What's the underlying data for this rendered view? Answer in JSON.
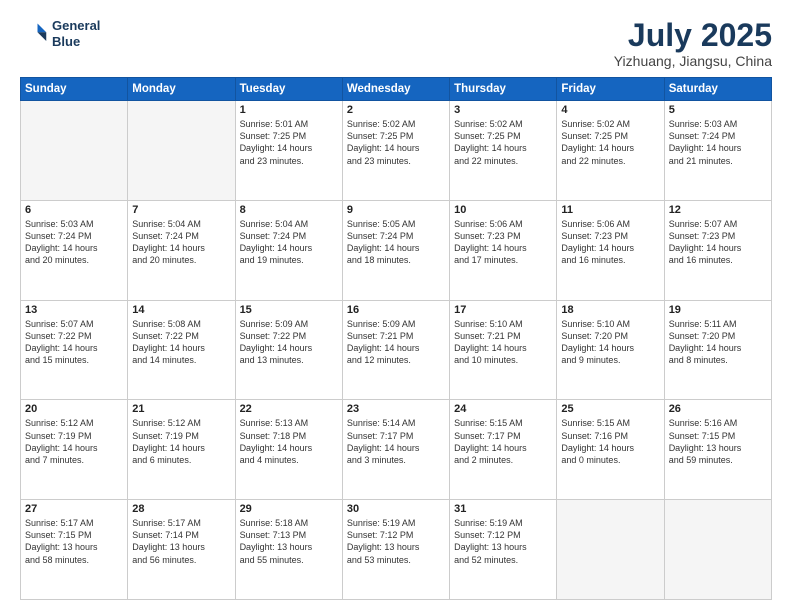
{
  "header": {
    "logo_line1": "General",
    "logo_line2": "Blue",
    "title": "July 2025",
    "subtitle": "Yizhuang, Jiangsu, China"
  },
  "calendar": {
    "days_of_week": [
      "Sunday",
      "Monday",
      "Tuesday",
      "Wednesday",
      "Thursday",
      "Friday",
      "Saturday"
    ],
    "weeks": [
      [
        {
          "day": "",
          "text": ""
        },
        {
          "day": "",
          "text": ""
        },
        {
          "day": "1",
          "text": "Sunrise: 5:01 AM\nSunset: 7:25 PM\nDaylight: 14 hours\nand 23 minutes."
        },
        {
          "day": "2",
          "text": "Sunrise: 5:02 AM\nSunset: 7:25 PM\nDaylight: 14 hours\nand 23 minutes."
        },
        {
          "day": "3",
          "text": "Sunrise: 5:02 AM\nSunset: 7:25 PM\nDaylight: 14 hours\nand 22 minutes."
        },
        {
          "day": "4",
          "text": "Sunrise: 5:02 AM\nSunset: 7:25 PM\nDaylight: 14 hours\nand 22 minutes."
        },
        {
          "day": "5",
          "text": "Sunrise: 5:03 AM\nSunset: 7:24 PM\nDaylight: 14 hours\nand 21 minutes."
        }
      ],
      [
        {
          "day": "6",
          "text": "Sunrise: 5:03 AM\nSunset: 7:24 PM\nDaylight: 14 hours\nand 20 minutes."
        },
        {
          "day": "7",
          "text": "Sunrise: 5:04 AM\nSunset: 7:24 PM\nDaylight: 14 hours\nand 20 minutes."
        },
        {
          "day": "8",
          "text": "Sunrise: 5:04 AM\nSunset: 7:24 PM\nDaylight: 14 hours\nand 19 minutes."
        },
        {
          "day": "9",
          "text": "Sunrise: 5:05 AM\nSunset: 7:24 PM\nDaylight: 14 hours\nand 18 minutes."
        },
        {
          "day": "10",
          "text": "Sunrise: 5:06 AM\nSunset: 7:23 PM\nDaylight: 14 hours\nand 17 minutes."
        },
        {
          "day": "11",
          "text": "Sunrise: 5:06 AM\nSunset: 7:23 PM\nDaylight: 14 hours\nand 16 minutes."
        },
        {
          "day": "12",
          "text": "Sunrise: 5:07 AM\nSunset: 7:23 PM\nDaylight: 14 hours\nand 16 minutes."
        }
      ],
      [
        {
          "day": "13",
          "text": "Sunrise: 5:07 AM\nSunset: 7:22 PM\nDaylight: 14 hours\nand 15 minutes."
        },
        {
          "day": "14",
          "text": "Sunrise: 5:08 AM\nSunset: 7:22 PM\nDaylight: 14 hours\nand 14 minutes."
        },
        {
          "day": "15",
          "text": "Sunrise: 5:09 AM\nSunset: 7:22 PM\nDaylight: 14 hours\nand 13 minutes."
        },
        {
          "day": "16",
          "text": "Sunrise: 5:09 AM\nSunset: 7:21 PM\nDaylight: 14 hours\nand 12 minutes."
        },
        {
          "day": "17",
          "text": "Sunrise: 5:10 AM\nSunset: 7:21 PM\nDaylight: 14 hours\nand 10 minutes."
        },
        {
          "day": "18",
          "text": "Sunrise: 5:10 AM\nSunset: 7:20 PM\nDaylight: 14 hours\nand 9 minutes."
        },
        {
          "day": "19",
          "text": "Sunrise: 5:11 AM\nSunset: 7:20 PM\nDaylight: 14 hours\nand 8 minutes."
        }
      ],
      [
        {
          "day": "20",
          "text": "Sunrise: 5:12 AM\nSunset: 7:19 PM\nDaylight: 14 hours\nand 7 minutes."
        },
        {
          "day": "21",
          "text": "Sunrise: 5:12 AM\nSunset: 7:19 PM\nDaylight: 14 hours\nand 6 minutes."
        },
        {
          "day": "22",
          "text": "Sunrise: 5:13 AM\nSunset: 7:18 PM\nDaylight: 14 hours\nand 4 minutes."
        },
        {
          "day": "23",
          "text": "Sunrise: 5:14 AM\nSunset: 7:17 PM\nDaylight: 14 hours\nand 3 minutes."
        },
        {
          "day": "24",
          "text": "Sunrise: 5:15 AM\nSunset: 7:17 PM\nDaylight: 14 hours\nand 2 minutes."
        },
        {
          "day": "25",
          "text": "Sunrise: 5:15 AM\nSunset: 7:16 PM\nDaylight: 14 hours\nand 0 minutes."
        },
        {
          "day": "26",
          "text": "Sunrise: 5:16 AM\nSunset: 7:15 PM\nDaylight: 13 hours\nand 59 minutes."
        }
      ],
      [
        {
          "day": "27",
          "text": "Sunrise: 5:17 AM\nSunset: 7:15 PM\nDaylight: 13 hours\nand 58 minutes."
        },
        {
          "day": "28",
          "text": "Sunrise: 5:17 AM\nSunset: 7:14 PM\nDaylight: 13 hours\nand 56 minutes."
        },
        {
          "day": "29",
          "text": "Sunrise: 5:18 AM\nSunset: 7:13 PM\nDaylight: 13 hours\nand 55 minutes."
        },
        {
          "day": "30",
          "text": "Sunrise: 5:19 AM\nSunset: 7:12 PM\nDaylight: 13 hours\nand 53 minutes."
        },
        {
          "day": "31",
          "text": "Sunrise: 5:19 AM\nSunset: 7:12 PM\nDaylight: 13 hours\nand 52 minutes."
        },
        {
          "day": "",
          "text": ""
        },
        {
          "day": "",
          "text": ""
        }
      ]
    ]
  }
}
